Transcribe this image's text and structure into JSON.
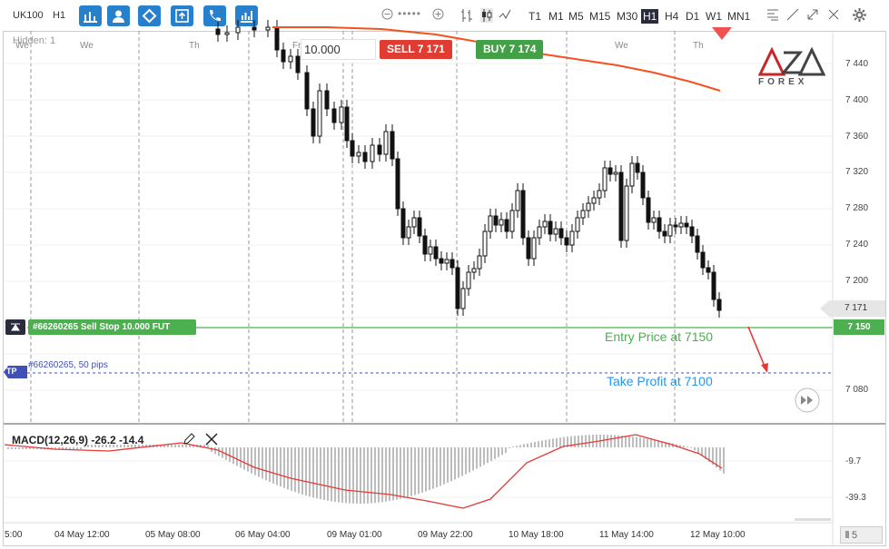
{
  "toolbar": {
    "symbol": "UK100",
    "interval": "H1",
    "timeframes": [
      "T1",
      "M1",
      "M5",
      "M15",
      "M30",
      "H1",
      "H4",
      "D1",
      "W1",
      "MN1"
    ],
    "active_timeframe": "H1"
  },
  "chart": {
    "hidden_label": "Hidden: 1",
    "lot_value": "10.000",
    "sell_label": "SELL 7 171",
    "buy_label": "BUY 7 174",
    "days": [
      "We",
      "Th",
      "Fr",
      "Su",
      "We",
      "Th"
    ],
    "order_label": "#66260265 Sell Stop 10.000 FUT",
    "tp_badge": "TP",
    "tp_label": "#66260265, 50 pips",
    "entry_annotation": "Entry Price at 7150",
    "tp_annotation": "Take Profit at 7100",
    "logo_text": "AZA",
    "logo_sub": "FOREX"
  },
  "price_axis": {
    "labels": [
      "7 440",
      "7 400",
      "7 360",
      "7 320",
      "7 280",
      "7 240",
      "7 200",
      "7 080"
    ],
    "current_price": "7 171",
    "entry_price": "7 150"
  },
  "macd": {
    "label": "MACD(12,26,9) -26.2 -14.4",
    "axis": [
      "-9.7",
      "-39.3"
    ]
  },
  "time_axis": {
    "labels": [
      "5:00",
      "04 May 12:00",
      "05 May 08:00",
      "06 May 04:00",
      "09 May 01:00",
      "09 May 22:00",
      "10 May 18:00",
      "11 May 14:00",
      "12 May 10:00"
    ]
  },
  "footer": {
    "page": "5"
  },
  "colors": {
    "toolbar_blue": "#2680cc",
    "sell": "#e03c31",
    "buy": "#43a047",
    "entry_line": "#4caf50",
    "tp_line": "#3f51b5",
    "ma_line": "#f4511e"
  }
}
